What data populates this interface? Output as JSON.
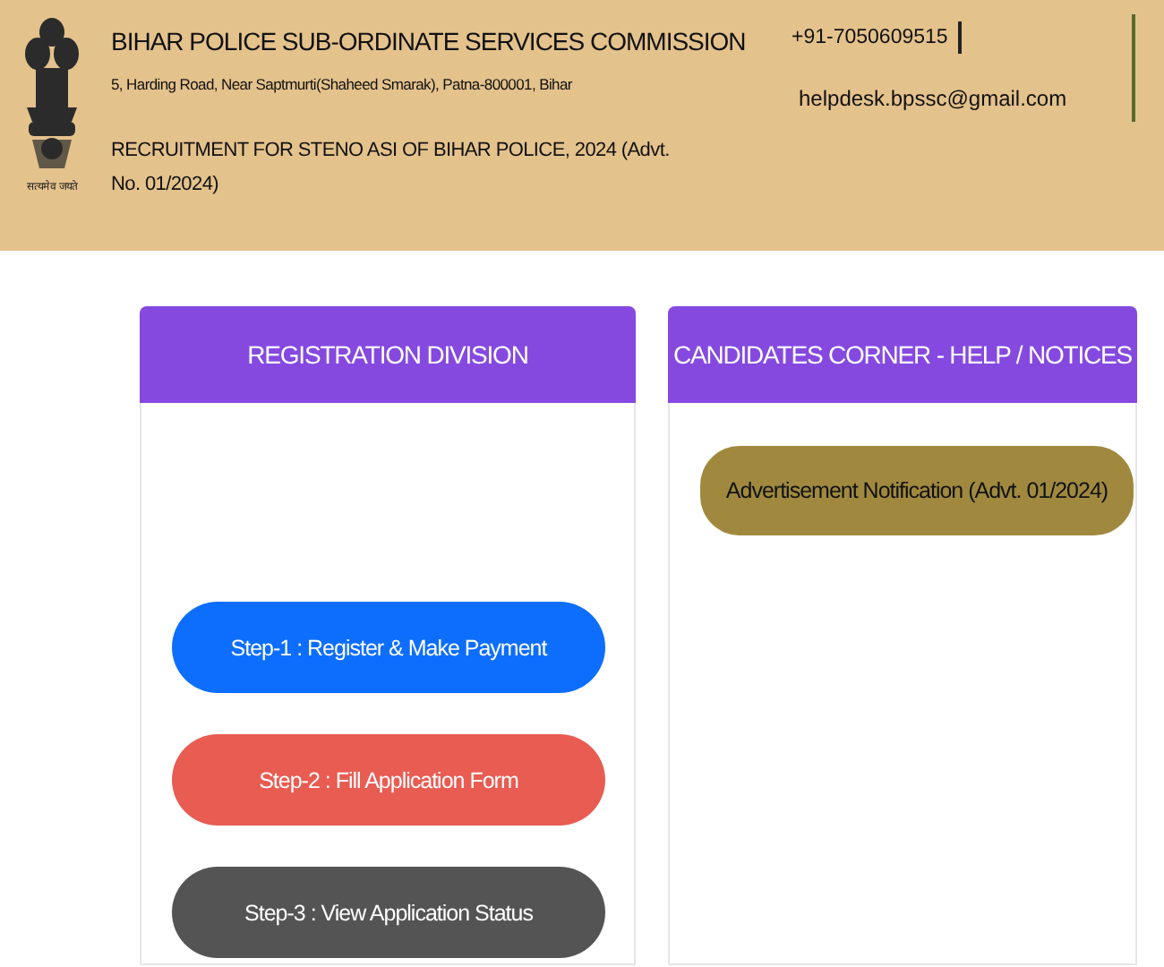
{
  "header": {
    "emblem_motto": "सत्यमेव जयते",
    "title": "BIHAR POLICE SUB-ORDINATE SERVICES COMMISSION",
    "address": "5, Harding Road, Near Saptmurti(Shaheed Smarak), Patna-800001, Bihar",
    "recruitment": "RECRUITMENT FOR STENO ASI OF BIHAR POLICE, 2024 (Advt. No. 01/2024)",
    "phone": "+91-7050609515",
    "email": "helpdesk.bpssc@gmail.com"
  },
  "panels": [
    {
      "title": "REGISTRATION DIVISION",
      "kind": "steps",
      "buttons": [
        {
          "label": "Step-1 : Register & Make Payment",
          "color": "#0d6efd"
        },
        {
          "label": "Step-2 : Fill Application Form",
          "color": "#e85c52"
        },
        {
          "label": "Step-3 : View Application Status",
          "color": "#545454"
        }
      ]
    },
    {
      "title": "CANDIDATES CORNER - HELP / NOTICES",
      "kind": "notices",
      "buttons": [
        {
          "label": "Advertisement Notification (Advt. 01/2024)",
          "color": "#a0893f"
        }
      ]
    }
  ]
}
